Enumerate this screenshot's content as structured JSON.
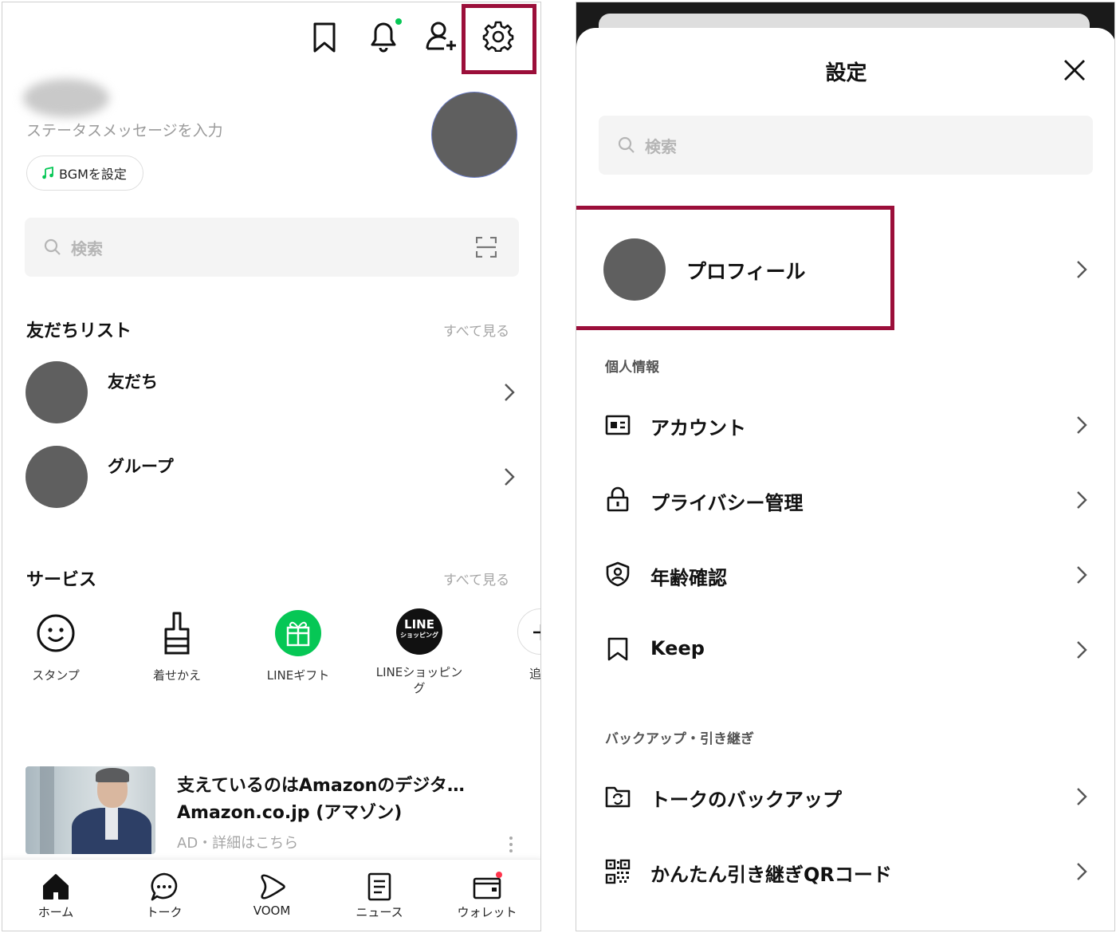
{
  "home": {
    "status_placeholder": "ステータスメッセージを入力",
    "bgm_button": "BGMを設定",
    "search_placeholder": "検索",
    "friends_section": {
      "title": "友だちリスト",
      "see_all": "すべて見る",
      "items": [
        {
          "label": "友だち"
        },
        {
          "label": "グループ"
        }
      ]
    },
    "services_section": {
      "title": "サービス",
      "see_all": "すべて見る",
      "items": [
        {
          "label": "スタンプ",
          "icon": "smile-icon"
        },
        {
          "label": "着せかえ",
          "icon": "brush-icon"
        },
        {
          "label": "LINEギフト",
          "icon": "gift-icon"
        },
        {
          "label": "LINEショッピング",
          "icon": "line-shopping-icon",
          "logo_top": "LINE",
          "logo_bottom": "ショッピング"
        },
        {
          "label": "追",
          "icon": "add-icon"
        }
      ]
    },
    "ad": {
      "title": "支えているのはAmazonのデジタ…",
      "subtitle": "Amazon.co.jp (アマゾン)",
      "meta": "AD・詳細はこちら"
    },
    "tabs": [
      {
        "label": "ホーム",
        "icon": "home-icon"
      },
      {
        "label": "トーク",
        "icon": "chat-icon"
      },
      {
        "label": "VOOM",
        "icon": "voom-icon"
      },
      {
        "label": "ニュース",
        "icon": "news-icon"
      },
      {
        "label": "ウォレット",
        "icon": "wallet-icon"
      }
    ],
    "colors": {
      "highlight": "#9b0f3a",
      "online_dot": "#06c755",
      "badge": "#ff334b",
      "gift": "#06c755"
    }
  },
  "settings": {
    "title": "設定",
    "search_placeholder": "検索",
    "profile_label": "プロフィール",
    "sections": [
      {
        "title": "個人情報",
        "items": [
          {
            "label": "アカウント",
            "icon": "id-card-icon"
          },
          {
            "label": "プライバシー管理",
            "icon": "lock-icon"
          },
          {
            "label": "年齢確認",
            "icon": "shield-user-icon"
          },
          {
            "label": "Keep",
            "icon": "bookmark-icon"
          }
        ]
      },
      {
        "title": "バックアップ・引き継ぎ",
        "items": [
          {
            "label": "トークのバックアップ",
            "icon": "folder-sync-icon"
          },
          {
            "label": "かんたん引き継ぎQRコード",
            "icon": "qr-code-icon"
          }
        ]
      }
    ]
  }
}
